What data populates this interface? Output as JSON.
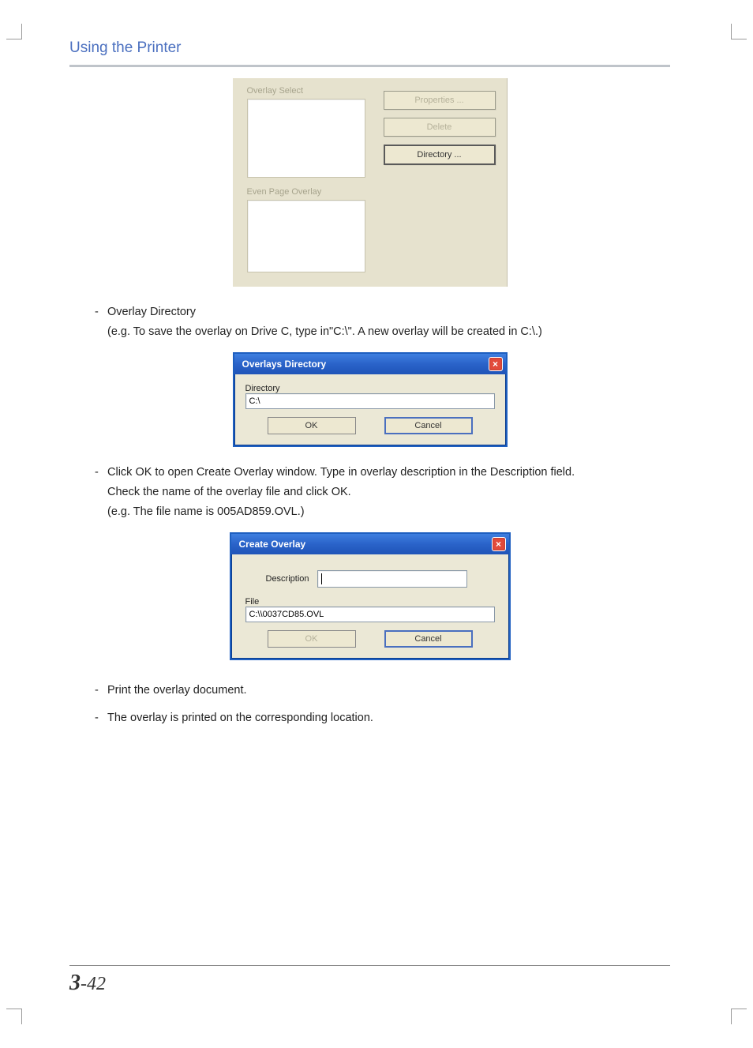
{
  "header": {
    "title": "Using the Printer"
  },
  "fig1": {
    "label_select": "Overlay Select",
    "label_even": "Even Page Overlay",
    "btn_properties": "Properties ...",
    "btn_delete": "Delete",
    "btn_directory": "Directory ..."
  },
  "text": {
    "item1_title": "Overlay Directory",
    "item1_sub": "(e.g. To save the overlay on Drive C, type in\"C:\\\". A new overlay will be created in C:\\.)",
    "item2_line1": "Click OK to open Create Overlay window. Type in overlay description in the Description field.",
    "item2_line2": "Check the name of the overlay file and click OK.",
    "item2_line3": "(e.g. The file name is 005AD859.OVL.)",
    "item3": "Print the overlay document.",
    "item4": "The overlay is printed on the corresponding location."
  },
  "dialog_overlays_dir": {
    "title": "Overlays Directory",
    "label": "Directory",
    "value": "C:\\",
    "ok": "OK",
    "cancel": "Cancel"
  },
  "dialog_create_overlay": {
    "title": "Create Overlay",
    "desc_label": "Description",
    "file_label": "File",
    "file_value": "C:\\\\0037CD85.OVL",
    "ok": "OK",
    "cancel": "Cancel"
  },
  "footer": {
    "chapter": "3",
    "sep": "-",
    "page": "42"
  }
}
